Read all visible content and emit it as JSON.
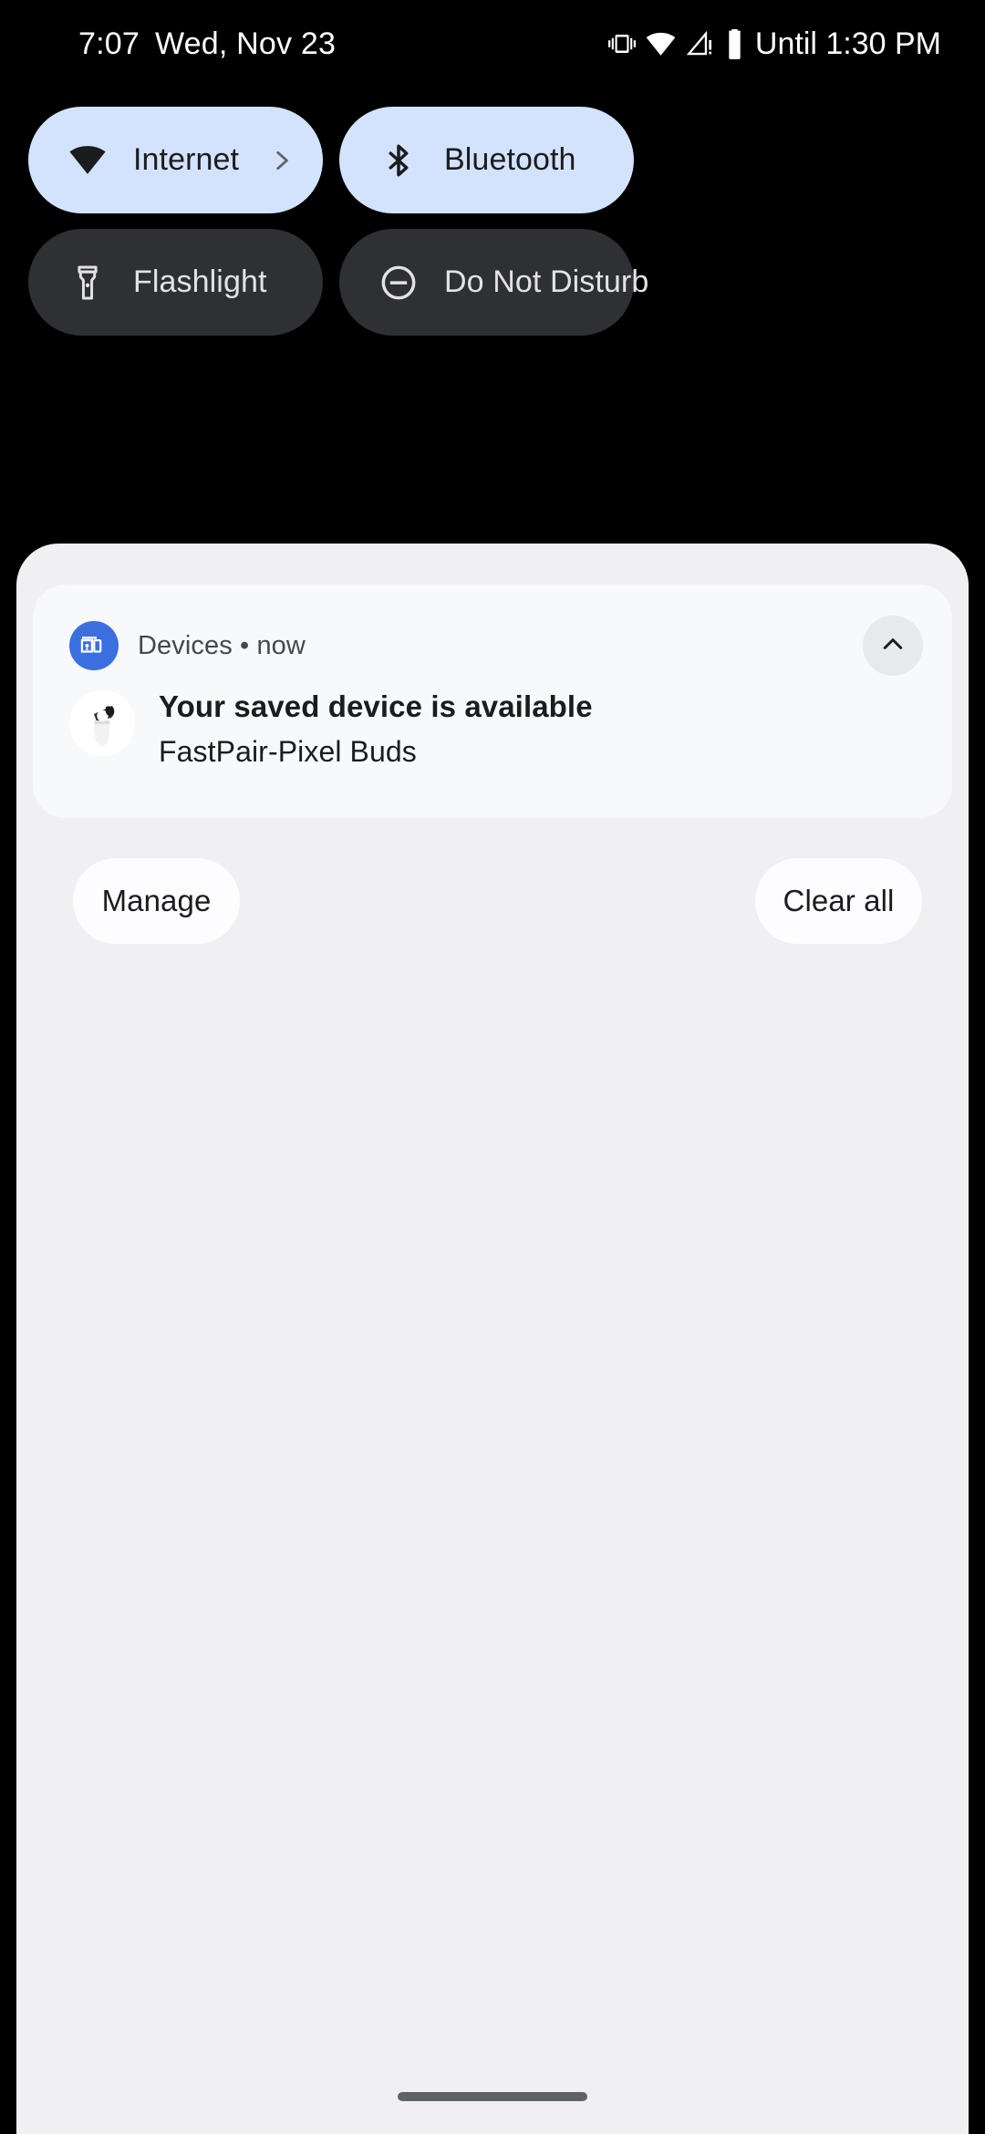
{
  "status_bar": {
    "time": "7:07",
    "date": "Wed, Nov 23",
    "battery_text": "Until 1:30 PM",
    "icons": [
      {
        "name": "vibrate-icon",
        "label": "Vibrate"
      },
      {
        "name": "wifi-icon",
        "label": "Wi-Fi full signal"
      },
      {
        "name": "no-signal-warning-icon",
        "label": "No mobile signal"
      },
      {
        "name": "battery-icon",
        "label": "Battery"
      }
    ]
  },
  "quick_settings": {
    "tiles": [
      {
        "label": "Internet",
        "icon": "wifi-icon",
        "state": "active",
        "has_chevron": true,
        "chevron_icon": "chevron-right-icon"
      },
      {
        "label": "Bluetooth",
        "icon": "bluetooth-icon",
        "state": "active",
        "has_chevron": false,
        "chevron_icon": ""
      },
      {
        "label": "Flashlight",
        "icon": "flashlight-icon",
        "state": "inactive",
        "has_chevron": false,
        "chevron_icon": ""
      },
      {
        "label": "Do Not Disturb",
        "icon": "do-not-disturb-icon",
        "state": "inactive",
        "has_chevron": false,
        "chevron_icon": ""
      }
    ],
    "colors": {
      "active_bg": "#D3E3FD",
      "active_fg": "#1B1C1E",
      "inactive_bg": "#2F3033",
      "inactive_fg": "#E3E3E6"
    }
  },
  "shade": {
    "background": "#F0F0F3",
    "notification": {
      "app_name": "Devices",
      "separator": "•",
      "time": "now",
      "app_icon": "devices-icon",
      "expand_icon": "chevron-up-icon",
      "device_image": "pixel-buds-case-image",
      "title": "Your saved device is available",
      "subtitle": "FastPair-Pixel Buds",
      "card_background": "#F8F9FB"
    },
    "footer": {
      "manage_label": "Manage",
      "clear_all_label": "Clear all"
    }
  },
  "navigation": {
    "gesture_pill": "home-gesture-pill"
  }
}
